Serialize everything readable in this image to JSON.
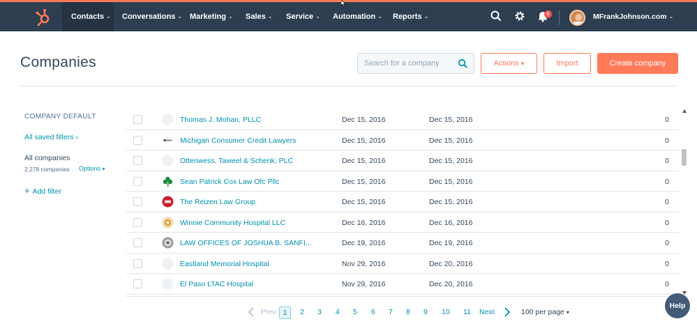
{
  "nav": {
    "items": [
      {
        "label": "Contacts"
      },
      {
        "label": "Conversations"
      },
      {
        "label": "Marketing"
      },
      {
        "label": "Sales"
      },
      {
        "label": "Service"
      },
      {
        "label": "Automation"
      },
      {
        "label": "Reports"
      }
    ],
    "chevron": "⌄",
    "notifications_count": "6",
    "user_name": "MFrankJohnson.com",
    "brand_color": "#ff7a59",
    "bar_color": "#2d3e50"
  },
  "header": {
    "title": "Companies",
    "search_placeholder": "Search for a company",
    "actions_label": "Actions",
    "actions_caret": "▾",
    "import_label": "Import",
    "create_label": "Create company"
  },
  "sidebar": {
    "heading": "COMPANY DEFAULT",
    "saved_filters": "All saved filters",
    "saved_filters_arrow": "›",
    "view_name": "All companies",
    "view_count": "2,278 companies",
    "options_label": "Options",
    "options_caret": "▾",
    "add_filter_plus": "+",
    "add_filter": "Add filter"
  },
  "table": {
    "rows": [
      {
        "name": "Thomas J. Mohan, PLLC",
        "date1": "Dec 15, 2016",
        "date2": "Dec 15, 2016",
        "count": "0",
        "logo": "blank"
      },
      {
        "name": "Michigan Consumer Credit Lawyers",
        "date1": "Dec 15, 2016",
        "date2": "Dec 15, 2016",
        "count": "0",
        "logo": "dots"
      },
      {
        "name": "Ottenwess, Taweel & Schenk, PLC",
        "date1": "Dec 15, 2016",
        "date2": "Dec 15, 2016",
        "count": "0",
        "logo": "blank"
      },
      {
        "name": "Sean Patrick Cox Law Ofc Pllc",
        "date1": "Dec 15, 2016",
        "date2": "Dec 15, 2016",
        "count": "0",
        "logo": "clover"
      },
      {
        "name": "The Reizen Law Group",
        "date1": "Dec 15, 2016",
        "date2": "Dec 15, 2016",
        "count": "0",
        "logo": "red"
      },
      {
        "name": "Winnie Community Hospital LLC",
        "date1": "Dec 16, 2016",
        "date2": "Dec 16, 2016",
        "count": "0",
        "logo": "gold"
      },
      {
        "name": "LAW OFFICES OF JOSHUA B. SANFI...",
        "date1": "Dec 19, 2016",
        "date2": "Dec 19, 2016",
        "count": "0",
        "logo": "gray"
      },
      {
        "name": "Eastland Memorial Hospital",
        "date1": "Nov 29, 2016",
        "date2": "Dec 20, 2016",
        "count": "0",
        "logo": "blank"
      },
      {
        "name": "El Paso LTAC Hospital",
        "date1": "Nov 29, 2016",
        "date2": "Dec 20, 2016",
        "count": "0",
        "logo": "blank"
      }
    ]
  },
  "pagination": {
    "prev": "Prev",
    "pages": [
      "1",
      "2",
      "3",
      "4",
      "5",
      "6",
      "7",
      "8",
      "9",
      "10",
      "11"
    ],
    "current": "1",
    "next": "Next",
    "per_page": "100 per page",
    "per_page_caret": "▾"
  },
  "help": {
    "label": "Help"
  }
}
